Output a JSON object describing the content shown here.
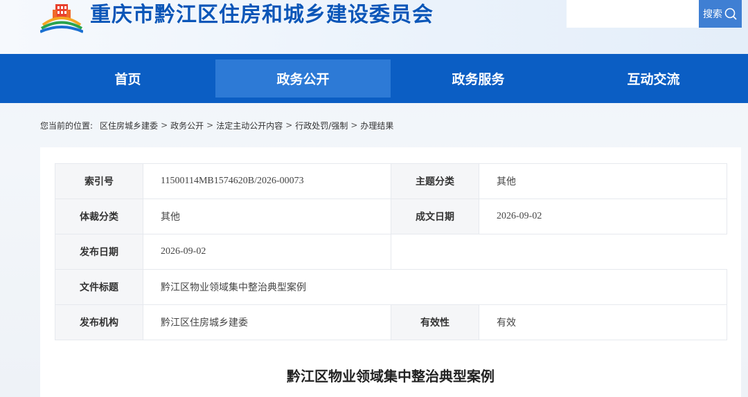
{
  "header": {
    "site_title": "重庆市黔江区住房和城乡建设委员会",
    "search_placeholder": "",
    "search_label": "搜索"
  },
  "nav": {
    "items": [
      {
        "label": "首页"
      },
      {
        "label": "政务公开"
      },
      {
        "label": "政务服务"
      },
      {
        "label": "互动交流"
      }
    ],
    "active_index": 1
  },
  "breadcrumb": {
    "prefix": "您当前的位置:",
    "items": [
      "区住房城乡建委",
      "政务公开",
      "法定主动公开内容",
      "行政处罚/强制",
      "办理结果"
    ],
    "separator": ">"
  },
  "meta": {
    "index_no_label": "索引号",
    "index_no": "11500114MB1574620B/2026-00073",
    "topic_label": "主题分类",
    "topic": "其他",
    "genre_label": "体裁分类",
    "genre": "其他",
    "written_date_label": "成文日期",
    "written_date": "2026-09-02",
    "publish_date_label": "发布日期",
    "publish_date": "2026-09-02",
    "doc_title_label": "文件标题",
    "doc_title": "黔江区物业领域集中整治典型案例",
    "issuer_label": "发布机构",
    "issuer": "黔江区住房城乡建委",
    "validity_label": "有效性",
    "validity": "有效"
  },
  "article": {
    "title": "黔江区物业领域集中整治典型案例"
  },
  "colors": {
    "brand_blue": "#0b5ec4",
    "title_blue": "#0b56b8",
    "active_nav": "#2d7ad6",
    "search_button": "#3f7fd3"
  }
}
